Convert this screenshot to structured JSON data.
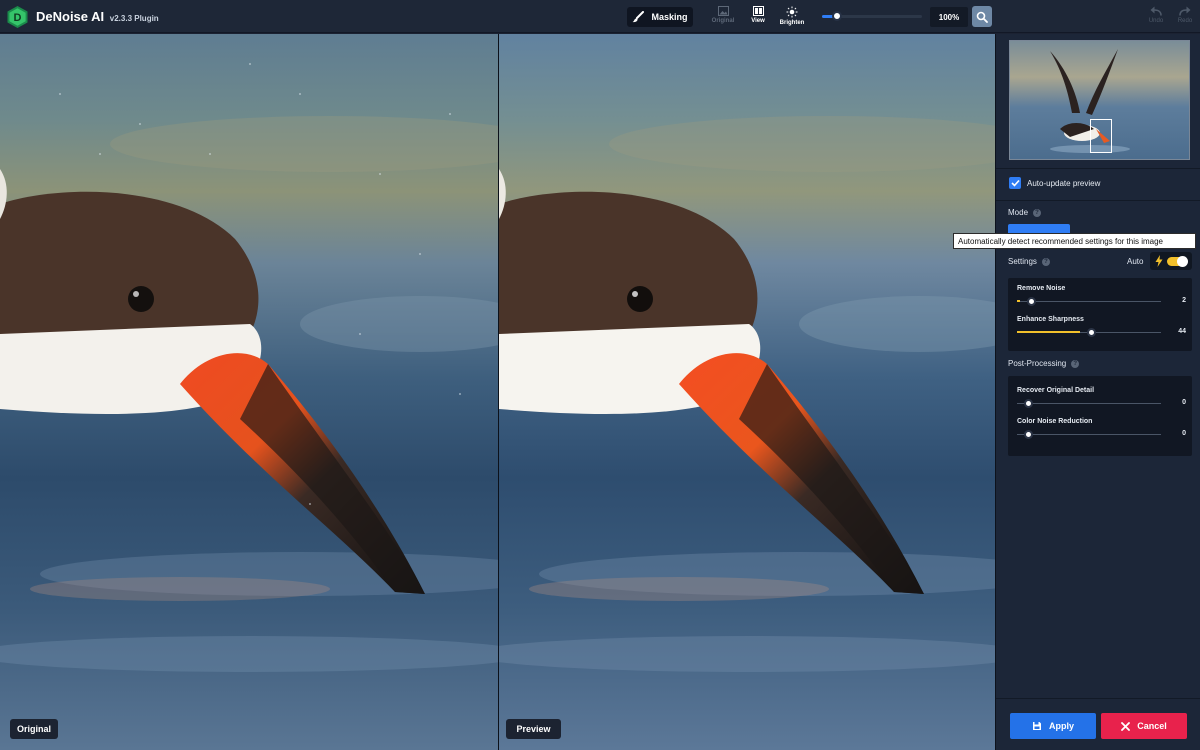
{
  "app": {
    "name": "DeNoise AI",
    "version": "v2.3.3 Plugin"
  },
  "toolbar": {
    "masking_label": "Masking",
    "original_label": "Original",
    "view_label": "View",
    "brighten_label": "Brighten",
    "zoom_value": "100%",
    "zoom_slider_fraction": 0.15,
    "undo_label": "Undo",
    "redo_label": "Redo"
  },
  "panes": {
    "original_label": "Original",
    "preview_label": "Preview"
  },
  "sidebar": {
    "auto_update_label": "Auto-update preview",
    "auto_update_checked": true,
    "mode_title": "Mode",
    "settings_title": "Settings",
    "auto_label": "Auto",
    "auto_enabled": true,
    "settings_sliders": [
      {
        "label": "Remove Noise",
        "value": "2",
        "fraction": 0.02
      },
      {
        "label": "Enhance Sharpness",
        "value": "44",
        "fraction": 0.44
      }
    ],
    "post_processing_title": "Post-Processing",
    "post_sliders": [
      {
        "label": "Recover Original Detail",
        "value": "0",
        "fraction": 0
      },
      {
        "label": "Color Noise Reduction",
        "value": "0",
        "fraction": 0
      }
    ],
    "apply_label": "Apply",
    "cancel_label": "Cancel"
  },
  "tooltip": {
    "text": "Automatically detect recommended settings for this image"
  },
  "colors": {
    "accent_blue": "#2f7df5",
    "slider_yellow": "#f2c02b",
    "cancel_red": "#e8224c",
    "app_bg": "#1c2638"
  },
  "icons": {
    "logo": "denoise-logo-icon",
    "masking": "brush-icon",
    "original": "image-icon",
    "view": "split-view-icon",
    "brighten": "sun-icon",
    "zoom": "magnifier-icon",
    "undo": "undo-arrow-icon",
    "redo": "redo-arrow-icon",
    "auto": "lightning-icon",
    "apply": "save-icon",
    "cancel": "close-icon"
  }
}
